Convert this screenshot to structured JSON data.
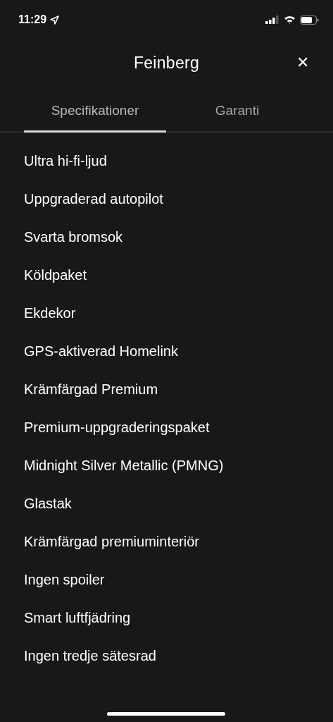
{
  "status_bar": {
    "time": "11:29"
  },
  "header": {
    "title": "Feinberg",
    "close": "✕"
  },
  "tabs": [
    {
      "label": "Specifikationer",
      "selected": true
    },
    {
      "label": "Garanti",
      "selected": false
    }
  ],
  "items": [
    "Ultra hi-fi-ljud",
    "Uppgraderad autopilot",
    "Svarta bromsok",
    "Köldpaket",
    "Ekdekor",
    "GPS-aktiverad Homelink",
    "Krämfärgad Premium",
    "Premium-uppgraderingspaket",
    "Midnight Silver Metallic (PMNG)",
    "Glastak",
    "Krämfärgad premiuminteriör",
    "Ingen spoiler",
    "Smart luftfjädring",
    "Ingen tredje sätesrad"
  ]
}
